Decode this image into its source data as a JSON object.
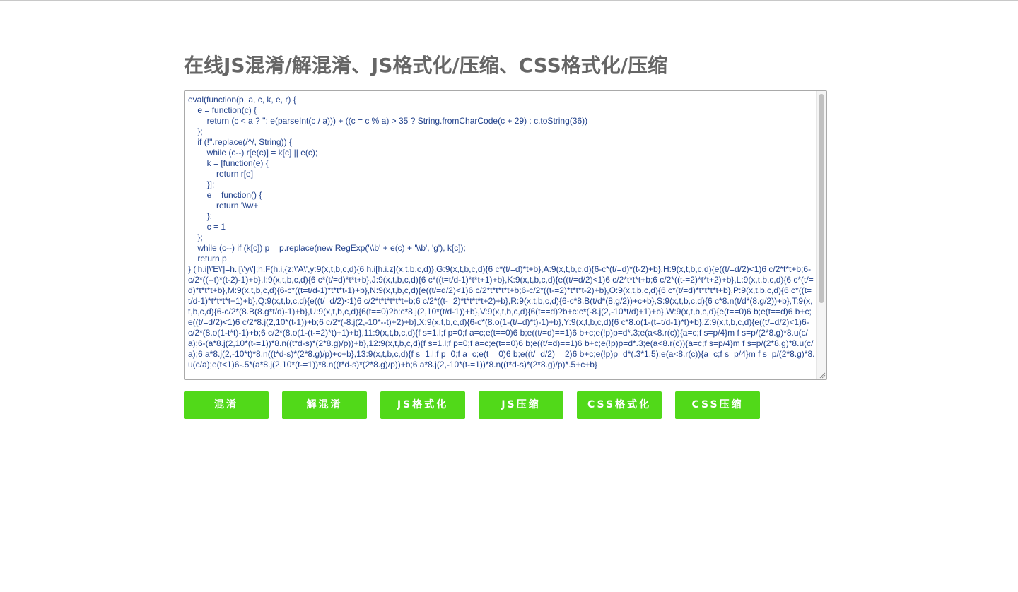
{
  "page": {
    "title": "在线JS混淆/解混淆、JS格式化/压缩、CSS格式化/压缩"
  },
  "editor": {
    "code": "eval(function(p, a, c, k, e, r) {\n    e = function(c) {\n        return (c < a ? '': e(parseInt(c / a))) + ((c = c % a) > 35 ? String.fromCharCode(c + 29) : c.toString(36))\n    };\n    if (!''.replace(/^/, String)) {\n        while (c--) r[e(c)] = k[c] || e(c);\n        k = [function(e) {\n            return r[e]\n        }];\n        e = function() {\n            return '\\\\w+'\n        };\n        c = 1\n    };\n    while (c--) if (k[c]) p = p.replace(new RegExp('\\\\b' + e(c) + '\\\\b', 'g'), k[c]);\n    return p\n} ('h.i[\\'E\\']=h.i[\\'y\\'];h.F(h.i,{z:\\'A\\',y:9(x,t,b,c,d){6 h.i[h.i.z](x,t,b,c,d)},G:9(x,t,b,c,d){6 c*(t/=d)*t+b},A:9(x,t,b,c,d){6-c*(t/=d)*(t-2)+b},H:9(x,t,b,c,d){e((t/=d/2)<1)6 c/2*t*t+b;6-c/2*((--t)*(t-2)-1)+b},I:9(x,t,b,c,d){6 c*(t/=d)*t*t+b},J:9(x,t,b,c,d){6 c*((t=t/d-1)*t*t+1)+b},K:9(x,t,b,c,d){e((t/=d/2)<1)6 c/2*t*t*t+b;6 c/2*((t-=2)*t*t+2)+b},L:9(x,t,b,c,d){6 c*(t/=d)*t*t*t+b},M:9(x,t,b,c,d){6-c*((t=t/d-1)*t*t*t-1)+b},N:9(x,t,b,c,d){e((t/=d/2)<1)6 c/2*t*t*t*t+b;6-c/2*((t-=2)*t*t*t-2)+b},O:9(x,t,b,c,d){6 c*(t/=d)*t*t*t*t+b},P:9(x,t,b,c,d){6 c*((t=t/d-1)*t*t*t*t+1)+b},Q:9(x,t,b,c,d){e((t/=d/2)<1)6 c/2*t*t*t*t*t+b;6 c/2*((t-=2)*t*t*t*t+2)+b},R:9(x,t,b,c,d){6-c*8.B(t/d*(8.g/2))+c+b},S:9(x,t,b,c,d){6 c*8.n(t/d*(8.g/2))+b},T:9(x,t,b,c,d){6-c/2*(8.B(8.g*t/d)-1)+b},U:9(x,t,b,c,d){6(t==0)?b:c*8.j(2,10*(t/d-1))+b},V:9(x,t,b,c,d){6(t==d)?b+c:c*(-8.j(2,-10*t/d)+1)+b},W:9(x,t,b,c,d){e(t==0)6 b;e(t==d)6 b+c;e((t/=d/2)<1)6 c/2*8.j(2,10*(t-1))+b;6 c/2*(-8.j(2,-10*--t)+2)+b},X:9(x,t,b,c,d){6-c*(8.o(1-(t/=d)*t)-1)+b},Y:9(x,t,b,c,d){6 c*8.o(1-(t=t/d-1)*t)+b},Z:9(x,t,b,c,d){e((t/=d/2)<1)6-c/2*(8.o(1-t*t)-1)+b;6 c/2*(8.o(1-(t-=2)*t)+1)+b},11:9(x,t,b,c,d){f s=1.l;f p=0;f a=c;e(t==0)6 b;e((t/=d)==1)6 b+c;e(!p)p=d*.3;e(a<8.r(c)){a=c;f s=p/4}m f s=p/(2*8.g)*8.u(c/a);6-(a*8.j(2,10*(t-=1))*8.n((t*d-s)*(2*8.g)/p))+b},12:9(x,t,b,c,d){f s=1.l;f p=0;f a=c;e(t==0)6 b;e((t/=d)==1)6 b+c;e(!p)p=d*.3;e(a<8.r(c)){a=c;f s=p/4}m f s=p/(2*8.g)*8.u(c/a);6 a*8.j(2,-10*t)*8.n((t*d-s)*(2*8.g)/p)+c+b},13:9(x,t,b,c,d){f s=1.l;f p=0;f a=c;e(t==0)6 b;e((t/=d/2)==2)6 b+c;e(!p)p=d*(.3*1.5);e(a<8.r(c)){a=c;f s=p/4}m f s=p/(2*8.g)*8.u(c/a);e(t<1)6-.5*(a*8.j(2,10*(t-=1))*8.n((t*d-s)*(2*8.g)/p))+b;6 a*8.j(2,-10*(t-=1))*8.n((t*d-s)*(2*8.g)/p)*.5+c+b}"
  },
  "buttons": {
    "obfuscate": "混淆",
    "deobfuscate": "解混淆",
    "js_format": "JS格式化",
    "js_compress": "JS压缩",
    "css_format": "CSS格式化",
    "css_compress": "CSS压缩"
  },
  "colors": {
    "button_bg": "#51d919",
    "title": "#666666",
    "code_text": "#1f3f8a"
  }
}
